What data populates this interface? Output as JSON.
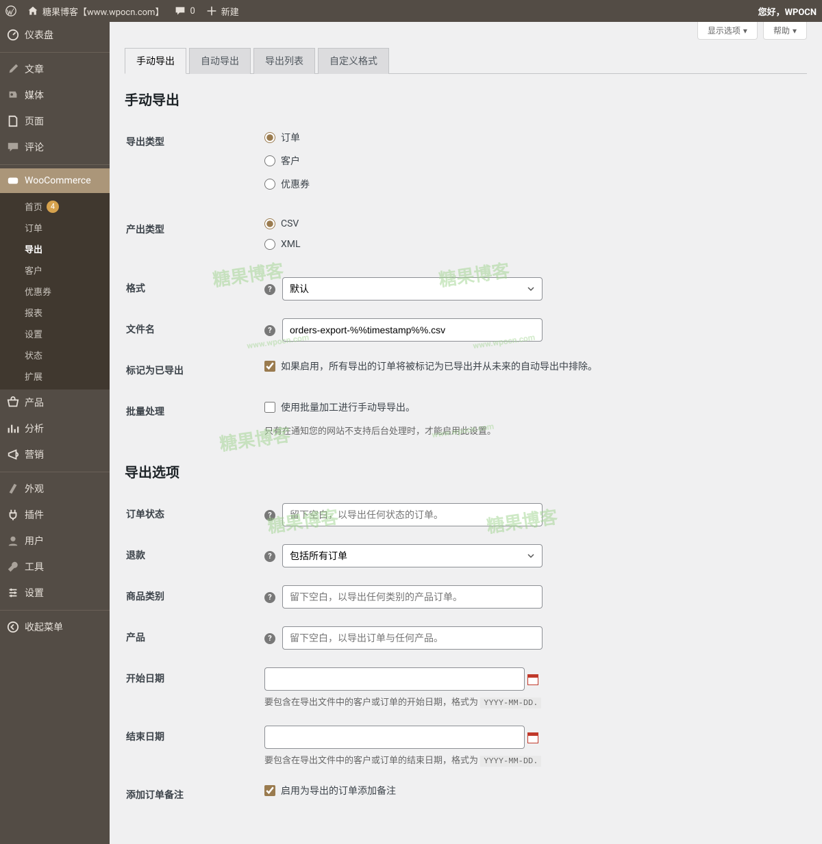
{
  "toolbar": {
    "site": "糖果博客【www.wpocn.com】",
    "comments": "0",
    "new": "新建",
    "greeting": "您好，WPOCN"
  },
  "screen": {
    "options": "显示选项",
    "help": "帮助"
  },
  "menu": {
    "dashboard": "仪表盘",
    "posts": "文章",
    "media": "媒体",
    "pages": "页面",
    "comments": "评论",
    "woo": "WooCommerce",
    "products": "产品",
    "analytics": "分析",
    "marketing": "营销",
    "appearance": "外观",
    "plugins": "插件",
    "users": "用户",
    "tools": "工具",
    "settings": "设置",
    "collapse": "收起菜单"
  },
  "submenu": {
    "home": "首页",
    "home_badge": "4",
    "orders": "订单",
    "export": "导出",
    "customers": "客户",
    "coupons": "优惠券",
    "reports": "报表",
    "settings": "设置",
    "status": "状态",
    "ext": "扩展"
  },
  "tabs": {
    "manual": "手动导出",
    "auto": "自动导出",
    "list": "导出列表",
    "custom": "自定义格式"
  },
  "h": {
    "manual": "手动导出",
    "options": "导出选项"
  },
  "labels": {
    "export_type": "导出类型",
    "output_type": "产出类型",
    "format": "格式",
    "filename": "文件名",
    "mark": "标记为已导出",
    "batch": "批量处理",
    "order_status": "订单状态",
    "refund": "退款",
    "category": "商品类别",
    "product": "产品",
    "start": "开始日期",
    "end": "结束日期",
    "notes": "添加订单备注"
  },
  "radios": {
    "orders": "订单",
    "customers": "客户",
    "coupons": "优惠券",
    "csv": "CSV",
    "xml": "XML"
  },
  "fields": {
    "format_default": "默认",
    "filename": "orders-export-%%timestamp%%.csv",
    "mark_label": "如果启用，所有导出的订单将被标记为已导出并从未来的自动导出中排除。",
    "batch_label": "使用批量加工进行手动导导出。",
    "batch_desc": "只有在通知您的网站不支持后台处理时，才能启用此设置。",
    "status_ph": "留下空白，以导出任何状态的订单。",
    "refund_opt": "包括所有订单",
    "category_ph": "留下空白，以导出任何类别的产品订单。",
    "product_ph": "留下空白，以导出订单与任何产品。",
    "start_desc_a": "要包含在导出文件中的客户或订单的开始日期，格式为",
    "end_desc_a": "要包含在导出文件中的客户或订单的结束日期，格式为",
    "date_fmt": "YYYY-MM-DD.",
    "notes_label": "启用为导出的订单添加备注"
  }
}
